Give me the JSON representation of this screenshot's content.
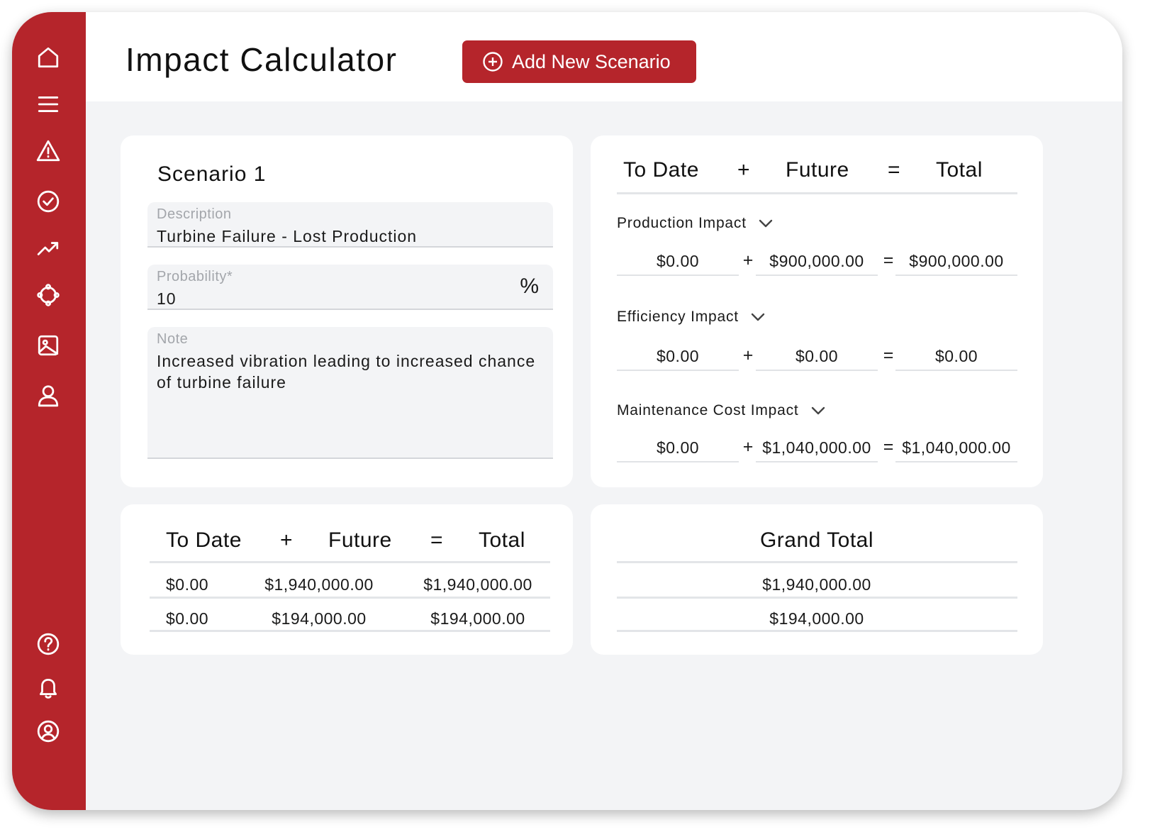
{
  "app": {
    "title": "Impact Calculator",
    "add_button_label": "Add New Scenario",
    "accent_color": "#b5252b"
  },
  "sidebar": {
    "top_items": [
      {
        "name": "home",
        "icon": "home-icon"
      },
      {
        "name": "menu",
        "icon": "menu-icon"
      },
      {
        "name": "alerts",
        "icon": "warning-icon"
      },
      {
        "name": "tasks",
        "icon": "check-circle-icon"
      },
      {
        "name": "trends",
        "icon": "trend-up-icon"
      },
      {
        "name": "network",
        "icon": "network-icon"
      },
      {
        "name": "images",
        "icon": "image-icon"
      },
      {
        "name": "users",
        "icon": "user-icon"
      }
    ],
    "bottom_items": [
      {
        "name": "help",
        "icon": "help-icon"
      },
      {
        "name": "notifications",
        "icon": "bell-icon"
      },
      {
        "name": "account",
        "icon": "account-circle-icon"
      }
    ]
  },
  "scenario": {
    "title": "Scenario 1",
    "description": {
      "label": "Description",
      "value": "Turbine Failure - Lost Production"
    },
    "probability": {
      "label": "Probability*",
      "value": "10",
      "suffix": "%"
    },
    "note": {
      "label": "Note",
      "value": "Increased vibration leading to increased chance of turbine failure"
    }
  },
  "impacts": {
    "headers": {
      "to_date": "To Date",
      "plus": "+",
      "future": "Future",
      "equals": "=",
      "total": "Total"
    },
    "rows": [
      {
        "label": "Production Impact",
        "to_date": "$0.00",
        "future": "$900,000.00",
        "total": "$900,000.00"
      },
      {
        "label": "Efficiency Impact",
        "to_date": "$0.00",
        "future": "$0.00",
        "total": "$0.00"
      },
      {
        "label": "Maintenance Cost Impact",
        "to_date": "$0.00",
        "future": "$1,040,000.00",
        "total": "$1,040,000.00"
      }
    ]
  },
  "summary": {
    "headers": {
      "to_date": "To Date",
      "plus": "+",
      "future": "Future",
      "equals": "=",
      "total": "Total"
    },
    "rows": [
      {
        "to_date": "$0.00",
        "future": "$1,940,000.00",
        "total": "$1,940,000.00"
      },
      {
        "to_date": "$0.00",
        "future": "$194,000.00",
        "total": "$194,000.00"
      }
    ]
  },
  "grand_total": {
    "title": "Grand Total",
    "rows": [
      "$1,940,000.00",
      "$194,000.00"
    ]
  }
}
